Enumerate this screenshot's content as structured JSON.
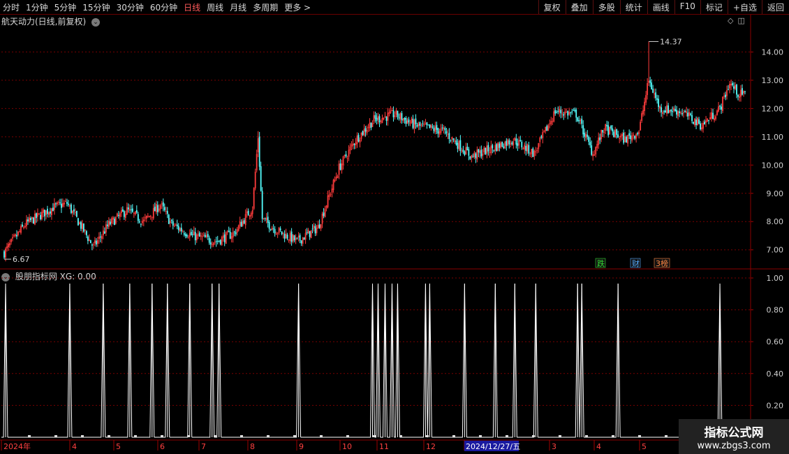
{
  "toolbar": {
    "periods": [
      "分时",
      "1分钟",
      "5分钟",
      "15分钟",
      "30分钟",
      "60分钟",
      "日线",
      "周线",
      "月线",
      "多周期",
      "更多 >"
    ],
    "active_index": 6,
    "right_buttons": [
      "复权",
      "叠加",
      "多股",
      "统计",
      "画线",
      "F10",
      "标记",
      "+自选",
      "返回"
    ]
  },
  "price_chart": {
    "title": "航天动力(日线,前复权)",
    "y_ticks": [
      14.0,
      13.0,
      12.0,
      11.0,
      10.0,
      9.0,
      8.0,
      7.0
    ],
    "ylim": [
      6.4,
      14.9
    ],
    "high_label": "14.37",
    "low_label": "6.67",
    "event_tags": [
      {
        "text": "跌",
        "color": "#33dd33"
      },
      {
        "text": "财",
        "color": "#55aaff"
      },
      {
        "text": "3榜",
        "color": "#ff8844"
      }
    ]
  },
  "indicator": {
    "title": "股朋指标网",
    "xg_label": "XG: 0.00",
    "y_ticks": [
      "1.00",
      "0.80",
      "0.60",
      "0.40",
      "0.20"
    ],
    "signal_indices": [
      1,
      47,
      71,
      90,
      106,
      117,
      133,
      149,
      154,
      211,
      264,
      268,
      273,
      278,
      282,
      302,
      305,
      330,
      352,
      366,
      381,
      411,
      414,
      440,
      513
    ]
  },
  "x_axis": {
    "labels": [
      "2024年",
      "4",
      "5",
      "6",
      "7",
      "8",
      "9",
      "10",
      "11",
      "12",
      "2024/12/27/五",
      "3",
      "4",
      "5"
    ]
  },
  "chart_data": {
    "type": "candlestick",
    "title": "航天动力(日线,前复权)",
    "y_range": [
      6.4,
      14.9
    ],
    "marked_high": 14.37,
    "marked_low": 6.67,
    "close_path": [
      [
        0,
        6.9
      ],
      [
        15,
        7.9
      ],
      [
        35,
        8.5
      ],
      [
        45,
        8.65
      ],
      [
        55,
        7.85
      ],
      [
        64,
        7.1
      ],
      [
        75,
        7.9
      ],
      [
        88,
        8.4
      ],
      [
        100,
        8.0
      ],
      [
        112,
        8.6
      ],
      [
        120,
        7.9
      ],
      [
        135,
        7.5
      ],
      [
        152,
        7.3
      ],
      [
        165,
        7.6
      ],
      [
        178,
        8.5
      ],
      [
        182,
        11.0
      ],
      [
        185,
        8.1
      ],
      [
        195,
        7.7
      ],
      [
        210,
        7.3
      ],
      [
        225,
        7.8
      ],
      [
        240,
        9.9
      ],
      [
        252,
        10.9
      ],
      [
        265,
        11.6
      ],
      [
        280,
        11.8
      ],
      [
        295,
        11.4
      ],
      [
        315,
        11.2
      ],
      [
        335,
        10.3
      ],
      [
        350,
        10.6
      ],
      [
        365,
        10.9
      ],
      [
        380,
        10.4
      ],
      [
        395,
        11.9
      ],
      [
        410,
        11.8
      ],
      [
        422,
        10.4
      ],
      [
        430,
        11.3
      ],
      [
        445,
        10.9
      ],
      [
        455,
        11.2
      ],
      [
        462,
        13.0
      ],
      [
        470,
        12.0
      ],
      [
        485,
        11.9
      ],
      [
        500,
        11.4
      ],
      [
        513,
        12.0
      ],
      [
        520,
        12.9
      ],
      [
        527,
        12.5
      ]
    ],
    "indicator_series": {
      "name": "XG",
      "values": "0/1 spikes at signal_indices",
      "ylim": [
        0,
        1
      ]
    }
  }
}
